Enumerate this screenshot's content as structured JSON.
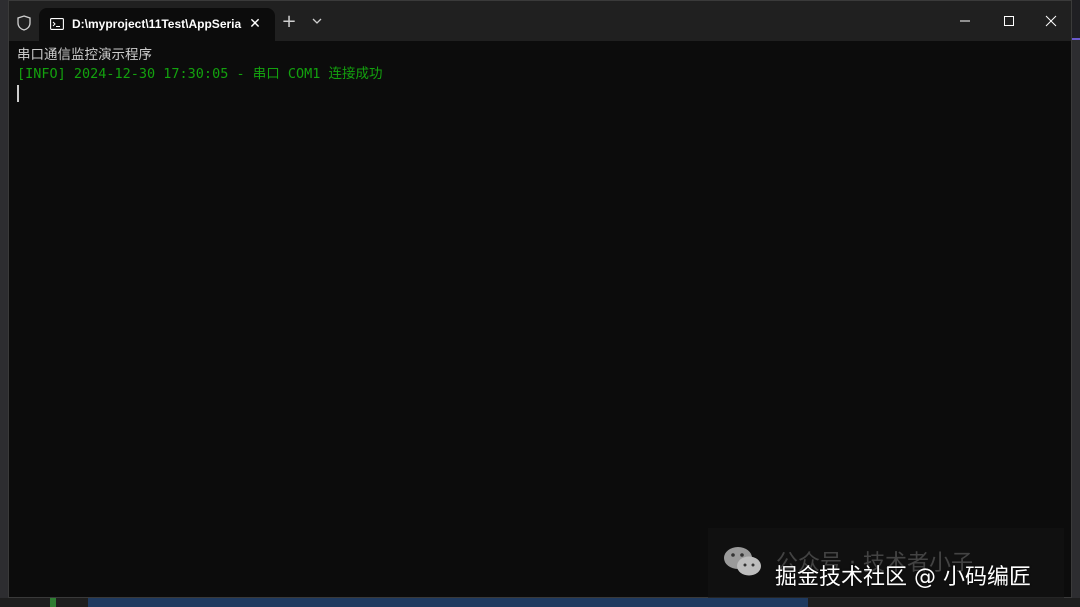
{
  "window": {
    "tab_title": "D:\\myproject\\11Test\\AppSeria",
    "tab_close_glyph": "✕",
    "new_tab_glyph": "+",
    "icons": {
      "shield": "shield-icon",
      "tab": "terminal-icon",
      "dropdown": "chevron-down-icon",
      "minimize": "minimize-icon",
      "maximize": "maximize-icon",
      "close": "close-icon"
    }
  },
  "console": {
    "lines": [
      {
        "text": "串口通信监控演示程序",
        "color": "#cccccc"
      },
      {
        "text": "[INFO] 2024-12-30 17:30:05 - 串口 COM1 连接成功",
        "color": "#13a10e"
      }
    ]
  },
  "watermark": {
    "faint_text": "公众号 · 技术者小子",
    "main_text": "掘金技术社区 @ 小码编匠",
    "icon": "wechat-icon"
  }
}
